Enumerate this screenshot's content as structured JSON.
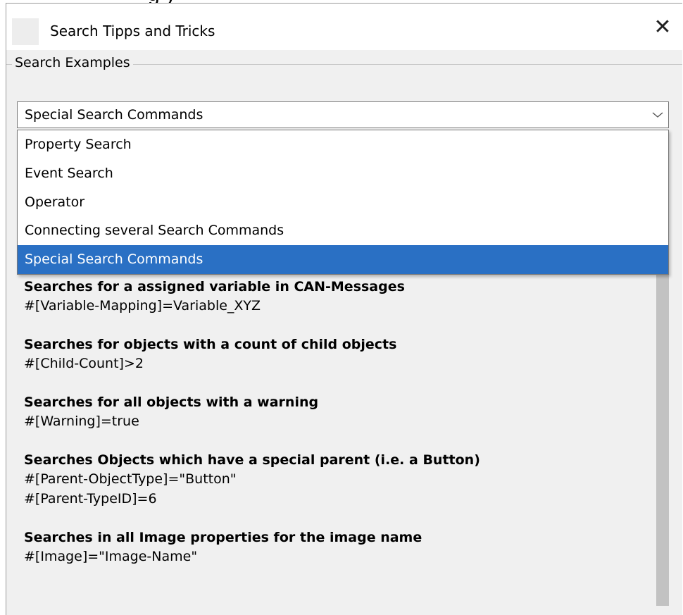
{
  "top_fragment": "g     y",
  "window": {
    "title": "Search Tipps and Tricks",
    "close_glyph": "✕"
  },
  "group": {
    "label": "Search Examples"
  },
  "combo": {
    "value": "Special Search Commands",
    "options": [
      "Property Search",
      "Event Search",
      "Operator",
      "Connecting several Search Commands",
      "Special Search Commands"
    ],
    "selected_index": 4
  },
  "examples": [
    {
      "title": "Searches for a assigned variable in CAN-Messages",
      "lines": [
        "#[Variable-Mapping]=Variable_XYZ"
      ]
    },
    {
      "title": "Searches for objects with a count of child objects",
      "lines": [
        "#[Child-Count]>2"
      ]
    },
    {
      "title": "Searches for all objects with a warning",
      "lines": [
        "#[Warning]=true"
      ]
    },
    {
      "title": "Searches Objects which have a special parent (i.e. a Button)",
      "lines": [
        "#[Parent-ObjectType]=\"Button\"",
        "#[Parent-TypeID]=6"
      ]
    },
    {
      "title": "Searches in all Image properties for the image name",
      "lines": [
        "#[Image]=\"Image-Name\""
      ]
    }
  ],
  "colors": {
    "selection": "#2a70c4",
    "dialog_bg": "#f0f0f0"
  },
  "icons": {
    "close": "close-icon",
    "chevron": "chevron-down-icon"
  }
}
